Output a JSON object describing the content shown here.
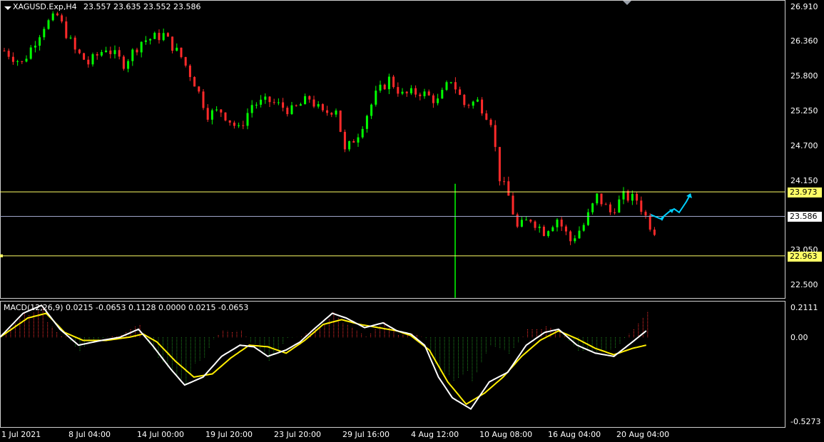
{
  "header": {
    "symbol": "XAGUSD.Exp,H4",
    "ohlc": "23.557 23.635 23.552 23.586"
  },
  "macd": {
    "label": "MACD(12,26,9) 0.0215 -0.0653 0.1128 0.0000 0.0215 -0.0653"
  },
  "price_axis": [
    "26.910",
    "26.360",
    "25.800",
    "25.250",
    "24.700",
    "24.150",
    "23.050",
    "22.500"
  ],
  "macd_axis": [
    "0.2111",
    "0.00",
    "-0.5273"
  ],
  "time_axis": [
    "1 Jul 2021",
    "8 Jul 04:00",
    "14 Jul 00:00",
    "19 Jul 20:00",
    "23 Jul 20:00",
    "29 Jul 16:00",
    "4 Aug 12:00",
    "10 Aug 08:00",
    "16 Aug 04:00",
    "20 Aug 04:00"
  ],
  "levels": {
    "resistance": "23.973",
    "current": "23.586",
    "support": "22.963"
  },
  "colors": {
    "bull": "#00ff00",
    "bear": "#ff2a2a",
    "level": "#ffff66",
    "current_line": "#9fa6c8",
    "macd_main": "#ffffff",
    "macd_signal": "#ffee00",
    "hist_pos": "#ff3030",
    "hist_neg": "#1f8a1f",
    "arrow": "#00d0ff"
  },
  "chart_data": {
    "type": "candlestick",
    "symbol": "XAGUSD.Exp",
    "timeframe": "H4",
    "ylim": [
      22.3,
      27.05
    ],
    "close_path": [
      [
        0,
        26.2
      ],
      [
        4,
        26.0
      ],
      [
        9,
        26.6
      ],
      [
        12,
        26.75
      ],
      [
        16,
        26.2
      ],
      [
        19,
        26.0
      ],
      [
        23,
        26.25
      ],
      [
        27,
        26.0
      ],
      [
        31,
        26.35
      ],
      [
        36,
        26.45
      ],
      [
        40,
        26.1
      ],
      [
        43,
        25.7
      ],
      [
        46,
        25.2
      ],
      [
        49,
        25.25
      ],
      [
        53,
        24.95
      ],
      [
        56,
        25.35
      ],
      [
        60,
        25.4
      ],
      [
        65,
        25.25
      ],
      [
        69,
        25.45
      ],
      [
        72,
        25.2
      ],
      [
        75,
        25.3
      ],
      [
        77,
        24.6
      ],
      [
        80,
        24.9
      ],
      [
        84,
        25.5
      ],
      [
        87,
        25.75
      ],
      [
        90,
        25.5
      ],
      [
        94,
        25.55
      ],
      [
        98,
        25.4
      ],
      [
        101,
        25.75
      ],
      [
        104,
        25.35
      ],
      [
        107,
        25.4
      ],
      [
        110,
        25.1
      ],
      [
        112,
        24.2
      ],
      [
        114,
        23.9
      ],
      [
        116,
        23.4
      ],
      [
        119,
        23.55
      ],
      [
        122,
        23.35
      ],
      [
        125,
        23.55
      ],
      [
        128,
        23.2
      ],
      [
        131,
        23.45
      ],
      [
        134,
        23.9
      ],
      [
        137,
        23.65
      ],
      [
        140,
        23.9
      ],
      [
        143,
        23.85
      ],
      [
        146,
        23.45
      ],
      [
        149,
        23.2
      ],
      [
        152,
        23.25
      ],
      [
        154,
        23.0
      ],
      [
        157,
        23.6
      ],
      [
        160,
        23.6
      ]
    ],
    "macd_main_path": [
      [
        0,
        0.0
      ],
      [
        5,
        0.15
      ],
      [
        9,
        0.2
      ],
      [
        13,
        0.05
      ],
      [
        17,
        -0.05
      ],
      [
        22,
        -0.02
      ],
      [
        26,
        0.0
      ],
      [
        30,
        0.05
      ],
      [
        33,
        -0.05
      ],
      [
        37,
        -0.2
      ],
      [
        40,
        -0.3
      ],
      [
        44,
        -0.25
      ],
      [
        48,
        -0.12
      ],
      [
        52,
        -0.05
      ],
      [
        55,
        -0.06
      ],
      [
        58,
        -0.12
      ],
      [
        62,
        -0.08
      ],
      [
        65,
        -0.03
      ],
      [
        68,
        0.05
      ],
      [
        72,
        0.15
      ],
      [
        75,
        0.12
      ],
      [
        79,
        0.06
      ],
      [
        83,
        0.09
      ],
      [
        86,
        0.04
      ],
      [
        89,
        0.02
      ],
      [
        92,
        -0.05
      ],
      [
        95,
        -0.25
      ],
      [
        98,
        -0.38
      ],
      [
        102,
        -0.45
      ],
      [
        106,
        -0.28
      ],
      [
        110,
        -0.22
      ],
      [
        114,
        -0.05
      ],
      [
        118,
        0.03
      ],
      [
        121,
        0.05
      ],
      [
        125,
        -0.05
      ],
      [
        129,
        -0.1
      ],
      [
        133,
        -0.12
      ],
      [
        137,
        -0.03
      ],
      [
        140,
        0.04
      ]
    ],
    "macd_signal_path": [
      [
        0,
        0.0
      ],
      [
        6,
        0.12
      ],
      [
        10,
        0.15
      ],
      [
        14,
        0.03
      ],
      [
        18,
        -0.02
      ],
      [
        23,
        -0.02
      ],
      [
        28,
        0.0
      ],
      [
        31,
        0.02
      ],
      [
        34,
        -0.03
      ],
      [
        38,
        -0.15
      ],
      [
        42,
        -0.25
      ],
      [
        46,
        -0.23
      ],
      [
        50,
        -0.13
      ],
      [
        54,
        -0.05
      ],
      [
        58,
        -0.06
      ],
      [
        62,
        -0.1
      ],
      [
        66,
        -0.02
      ],
      [
        70,
        0.08
      ],
      [
        74,
        0.11
      ],
      [
        78,
        0.08
      ],
      [
        82,
        0.06
      ],
      [
        86,
        0.04
      ],
      [
        89,
        0.01
      ],
      [
        93,
        -0.08
      ],
      [
        97,
        -0.28
      ],
      [
        101,
        -0.42
      ],
      [
        105,
        -0.35
      ],
      [
        109,
        -0.25
      ],
      [
        113,
        -0.12
      ],
      [
        117,
        -0.02
      ],
      [
        121,
        0.04
      ],
      [
        125,
        -0.01
      ],
      [
        129,
        -0.07
      ],
      [
        133,
        -0.11
      ],
      [
        137,
        -0.07
      ],
      [
        140,
        -0.05
      ]
    ]
  }
}
